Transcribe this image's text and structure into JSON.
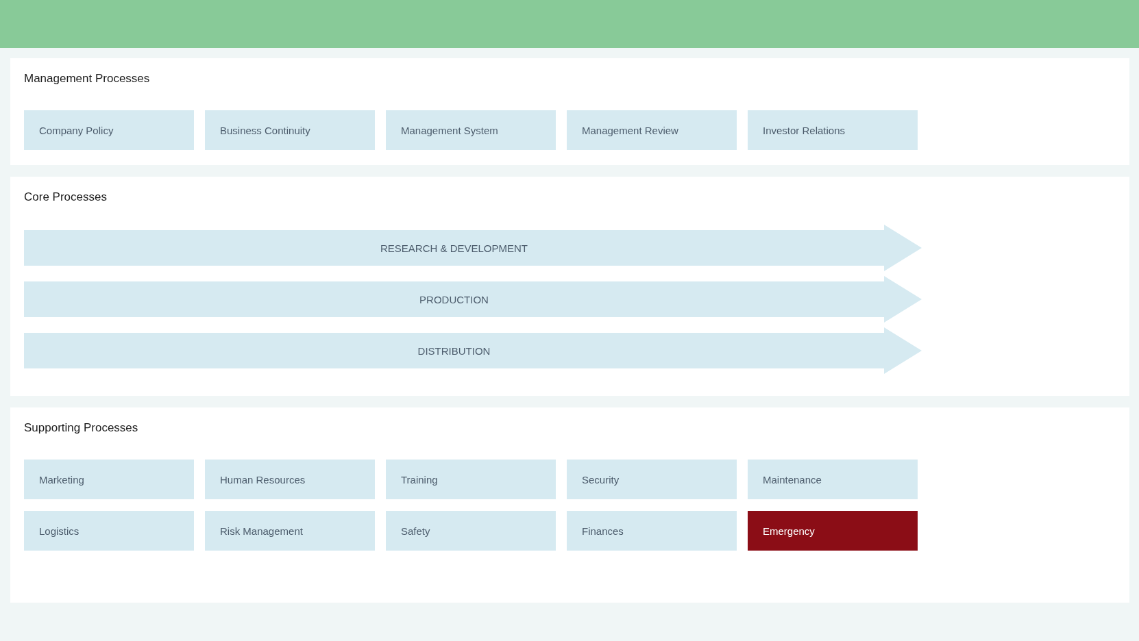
{
  "management": {
    "title": "Management Processes",
    "items": [
      {
        "label": "Company Policy",
        "highlighted": false
      },
      {
        "label": "Business Continuity",
        "highlighted": false
      },
      {
        "label": "Management System",
        "highlighted": false
      },
      {
        "label": "Management Review",
        "highlighted": false
      },
      {
        "label": "Investor Relations",
        "highlighted": false
      }
    ]
  },
  "core": {
    "title": "Core Processes",
    "arrows": [
      {
        "label": "RESEARCH & DEVELOPMENT"
      },
      {
        "label": "PRODUCTION"
      },
      {
        "label": "DISTRIBUTION"
      }
    ]
  },
  "supporting": {
    "title": "Supporting Processes",
    "items": [
      {
        "label": "Marketing",
        "highlighted": false
      },
      {
        "label": "Human Resources",
        "highlighted": false
      },
      {
        "label": "Training",
        "highlighted": false
      },
      {
        "label": "Security",
        "highlighted": false
      },
      {
        "label": "Maintenance",
        "highlighted": false
      },
      {
        "label": "Logistics",
        "highlighted": false
      },
      {
        "label": "Risk Management",
        "highlighted": false
      },
      {
        "label": "Safety",
        "highlighted": false
      },
      {
        "label": "Finances",
        "highlighted": false
      },
      {
        "label": "Emergency",
        "highlighted": true
      }
    ]
  }
}
